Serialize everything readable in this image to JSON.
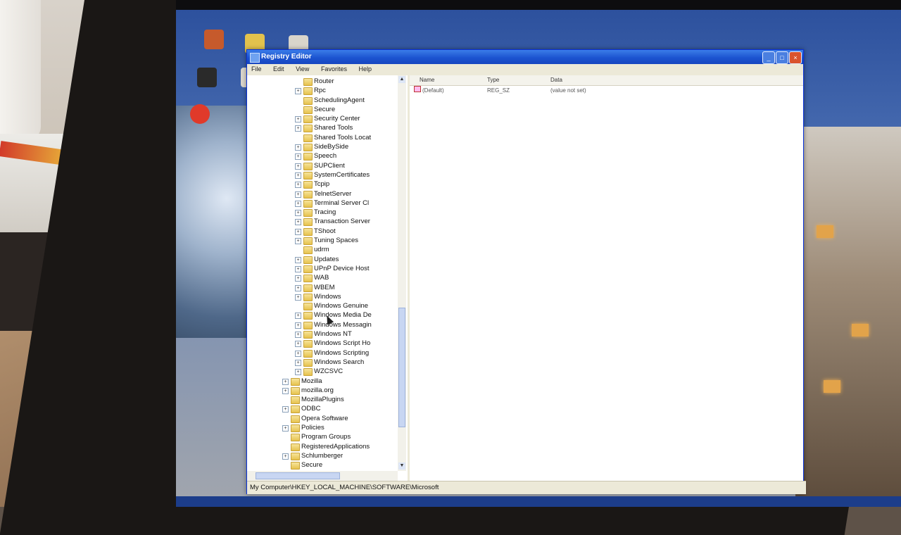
{
  "window": {
    "title": "Registry Editor",
    "minimize_glyph": "_",
    "maximize_glyph": "□",
    "close_glyph": "×"
  },
  "menu": [
    {
      "label": "File"
    },
    {
      "label": "Edit"
    },
    {
      "label": "View"
    },
    {
      "label": "Favorites"
    },
    {
      "label": "Help"
    }
  ],
  "tree": [
    {
      "label": "Router",
      "level": 3,
      "expander": ""
    },
    {
      "label": "Rpc",
      "level": 3,
      "expander": "+"
    },
    {
      "label": "SchedulingAgent",
      "level": 3,
      "expander": ""
    },
    {
      "label": "Secure",
      "level": 3,
      "expander": ""
    },
    {
      "label": "Security Center",
      "level": 3,
      "expander": "+"
    },
    {
      "label": "Shared Tools",
      "level": 3,
      "expander": "+"
    },
    {
      "label": "Shared Tools Locat",
      "level": 3,
      "expander": ""
    },
    {
      "label": "SideBySide",
      "level": 3,
      "expander": "+"
    },
    {
      "label": "Speech",
      "level": 3,
      "expander": "+"
    },
    {
      "label": "SUPClient",
      "level": 3,
      "expander": "+"
    },
    {
      "label": "SystemCertificates",
      "level": 3,
      "expander": "+"
    },
    {
      "label": "Tcpip",
      "level": 3,
      "expander": "+"
    },
    {
      "label": "TelnetServer",
      "level": 3,
      "expander": "+"
    },
    {
      "label": "Terminal Server Cl",
      "level": 3,
      "expander": "+"
    },
    {
      "label": "Tracing",
      "level": 3,
      "expander": "+"
    },
    {
      "label": "Transaction Server",
      "level": 3,
      "expander": "+"
    },
    {
      "label": "TShoot",
      "level": 3,
      "expander": "+"
    },
    {
      "label": "Tuning Spaces",
      "level": 3,
      "expander": "+"
    },
    {
      "label": "udrm",
      "level": 3,
      "expander": ""
    },
    {
      "label": "Updates",
      "level": 3,
      "expander": "+"
    },
    {
      "label": "UPnP Device Host",
      "level": 3,
      "expander": "+"
    },
    {
      "label": "WAB",
      "level": 3,
      "expander": "+"
    },
    {
      "label": "WBEM",
      "level": 3,
      "expander": "+"
    },
    {
      "label": "Windows",
      "level": 3,
      "expander": "+"
    },
    {
      "label": "Windows Genuine",
      "level": 3,
      "expander": ""
    },
    {
      "label": "Windows Media De",
      "level": 3,
      "expander": "+"
    },
    {
      "label": "Windows Messagin",
      "level": 3,
      "expander": "+"
    },
    {
      "label": "Windows NT",
      "level": 3,
      "expander": "+"
    },
    {
      "label": "Windows Script Ho",
      "level": 3,
      "expander": "+"
    },
    {
      "label": "Windows Scripting",
      "level": 3,
      "expander": "+"
    },
    {
      "label": "Windows Search",
      "level": 3,
      "expander": "+"
    },
    {
      "label": "WZCSVC",
      "level": 3,
      "expander": "+"
    },
    {
      "label": "Mozilla",
      "level": 2,
      "expander": "+"
    },
    {
      "label": "mozilla.org",
      "level": 2,
      "expander": "+"
    },
    {
      "label": "MozillaPlugins",
      "level": 2,
      "expander": ""
    },
    {
      "label": "ODBC",
      "level": 2,
      "expander": "+"
    },
    {
      "label": "Opera Software",
      "level": 2,
      "expander": ""
    },
    {
      "label": "Policies",
      "level": 2,
      "expander": "+"
    },
    {
      "label": "Program Groups",
      "level": 2,
      "expander": ""
    },
    {
      "label": "RegisteredApplications",
      "level": 2,
      "expander": ""
    },
    {
      "label": "Schlumberger",
      "level": 2,
      "expander": "+"
    },
    {
      "label": "Secure",
      "level": 2,
      "expander": ""
    }
  ],
  "list": {
    "columns": [
      "Name",
      "Type",
      "Data"
    ],
    "rows": [
      {
        "name": "(Default)",
        "type": "REG_SZ",
        "data": "(value not set)"
      }
    ]
  },
  "statusbar": {
    "path": "My Computer\\HKEY_LOCAL_MACHINE\\SOFTWARE\\Microsoft"
  },
  "colors": {
    "titlebar": "#1c54d0",
    "desktop": "#2b4f9c",
    "folder": "#e6c24e"
  }
}
